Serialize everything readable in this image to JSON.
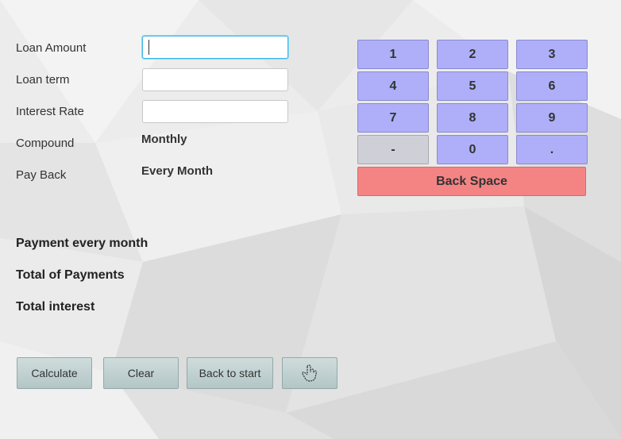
{
  "form": {
    "loan_amount_label": "Loan Amount",
    "loan_term_label": "Loan term",
    "interest_rate_label": "Interest Rate",
    "compound_label": "Compound",
    "compound_value": "Monthly",
    "pay_back_label": "Pay Back",
    "pay_back_value": "Every Month",
    "loan_amount_value": "",
    "loan_term_value": "",
    "interest_rate_value": ""
  },
  "results": {
    "payment_label": "Payment every month",
    "total_payments_label": "Total of Payments",
    "total_interest_label": "Total interest"
  },
  "keypad": {
    "k1": "1",
    "k2": "2",
    "k3": "3",
    "k4": "4",
    "k5": "5",
    "k6": "6",
    "k7": "7",
    "k8": "8",
    "k9": "9",
    "minus": "-",
    "k0": "0",
    "dot": ".",
    "backspace": "Back Space"
  },
  "actions": {
    "calculate": "Calculate",
    "clear": "Clear",
    "back_to_start": "Back to start",
    "gesture_icon": "hand-pointer-icon"
  },
  "colors": {
    "keypad_key": "#aeaff8",
    "minus_key": "#cfcfd8",
    "backspace_key": "#f48484",
    "focus_ring": "#3fb8e8"
  }
}
